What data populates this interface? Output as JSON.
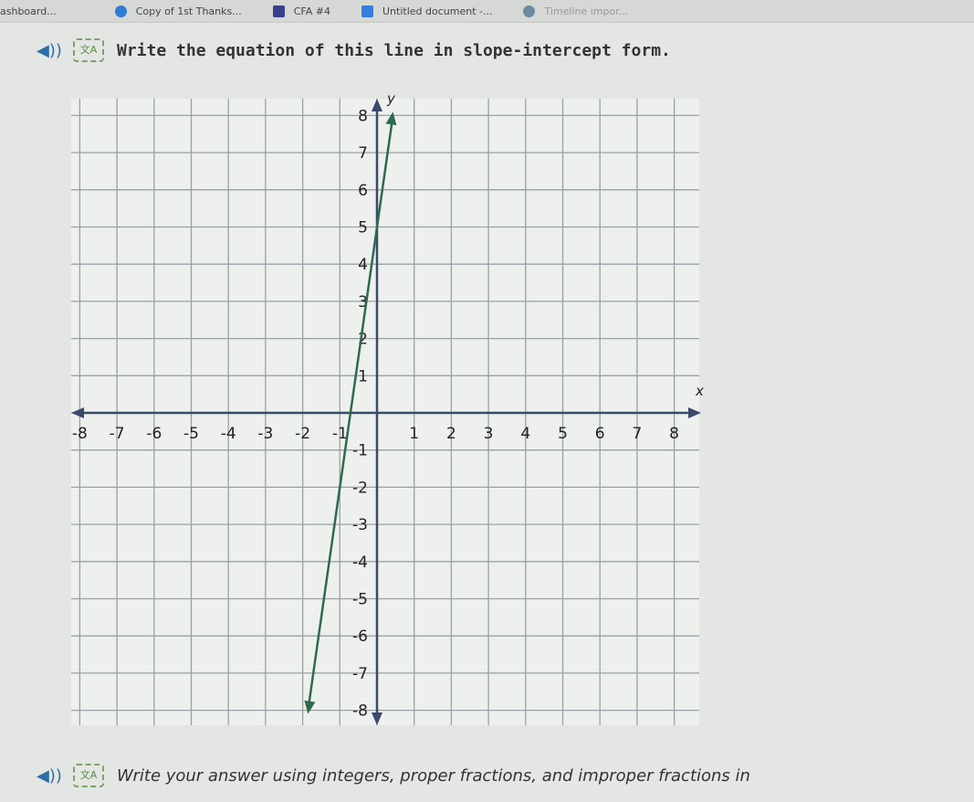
{
  "tabs": [
    {
      "label": "ashboard...",
      "icon": "none"
    },
    {
      "label": "Copy of 1st Thanks...",
      "icon": "globe-icon"
    },
    {
      "label": "CFA #4",
      "icon": "form-icon"
    },
    {
      "label": "Untitled document -...",
      "icon": "docs-icon"
    },
    {
      "label": "Timeline impor...",
      "icon": "app-icon"
    }
  ],
  "question": {
    "prompt": "Write the equation of this line in slope-intercept form.",
    "instruction": "Write your answer using integers, proper fractions, and improper fractions in"
  },
  "colors": {
    "line": "#2e6b4a",
    "axis": "#3a4a6a",
    "grid": "#9aa0a6"
  },
  "chart_data": {
    "type": "line",
    "xlim": [
      -8,
      8
    ],
    "ylim": [
      -8,
      8
    ],
    "xlabel": "x",
    "ylabel": "y",
    "x_ticks": [
      "-8",
      "-7",
      "-6",
      "-5",
      "-4",
      "-3",
      "-2",
      "-1",
      "1",
      "2",
      "3",
      "4",
      "5",
      "6",
      "7",
      "8"
    ],
    "y_ticks": [
      "8",
      "7",
      "6",
      "5",
      "4",
      "3",
      "2",
      "1",
      "-1",
      "-2",
      "-3",
      "-4",
      "-5",
      "-6",
      "-7",
      "-8"
    ],
    "grid": true,
    "line": {
      "slope": 7,
      "intercept": 5,
      "points": [
        [
          -1.857,
          -8
        ],
        [
          0.429,
          8
        ]
      ],
      "arrows": "both"
    }
  }
}
